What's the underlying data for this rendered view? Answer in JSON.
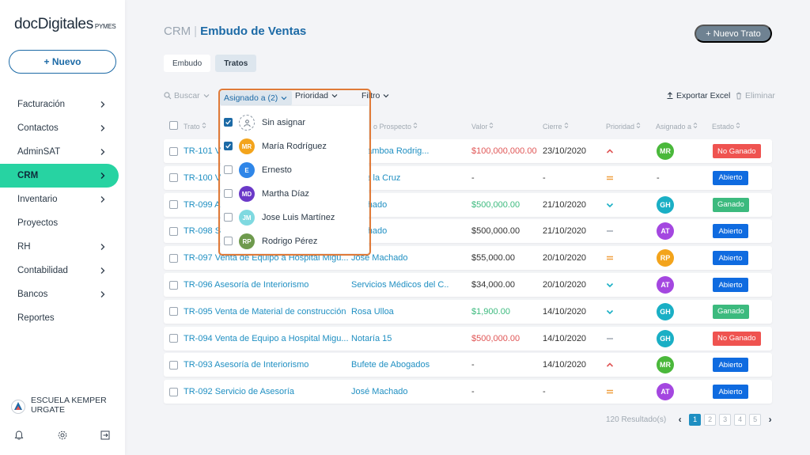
{
  "sidebar": {
    "logo_main": "docDigitales",
    "logo_sub": "PYMES",
    "new_label": "+ Nuevo",
    "items": [
      {
        "label": "Facturación",
        "chevron": true
      },
      {
        "label": "Contactos",
        "chevron": true
      },
      {
        "label": "AdminSAT",
        "chevron": true
      },
      {
        "label": "CRM",
        "chevron": true,
        "active": true
      },
      {
        "label": "Inventario",
        "chevron": true
      },
      {
        "label": "Proyectos",
        "chevron": false
      },
      {
        "label": "RH",
        "chevron": true
      },
      {
        "label": "Contabilidad",
        "chevron": true
      },
      {
        "label": "Bancos",
        "chevron": true
      },
      {
        "label": "Reportes",
        "chevron": false
      }
    ],
    "company_line1": "ESCUELA KEMPER",
    "company_line2": "URGATE"
  },
  "header": {
    "crumb_root": "CRM",
    "crumb_sep": "|",
    "crumb_current": "Embudo de Ventas",
    "new_deal_label": "+ Nuevo Trato"
  },
  "tabs": [
    {
      "label": "Embudo",
      "active": false
    },
    {
      "label": "Tratos",
      "active": true
    }
  ],
  "toolbar": {
    "search": "Buscar",
    "assigned": "Asignado a (2)",
    "priority": "Prioridad",
    "filter": "Filtro",
    "export": "Exportar Excel",
    "delete": "Eliminar"
  },
  "columns": {
    "deal": "Trato",
    "prospect": "o Prospecto",
    "value": "Valor",
    "close": "Cierre",
    "priority": "Prioridad",
    "assigned": "Asignado a",
    "status": "Estado"
  },
  "rows": [
    {
      "deal": "TR-101 V",
      "prospect": "io Gamboa Rodrig...",
      "value": "$100,000,000.00",
      "value_color": "red",
      "close": "23/10/2020",
      "priority": "up",
      "avatar": "MR",
      "avatar_color": "#4ab83b",
      "status": "No Ganado",
      "status_color": "#ef5350"
    },
    {
      "deal": "TR-100 V",
      "prospect": "to de la Cruz",
      "value": "-",
      "value_color": "plain",
      "close": "-",
      "priority": "equal",
      "avatar": "-",
      "avatar_color": "",
      "status": "Abierto",
      "status_color": "#0f6be0"
    },
    {
      "deal": "TR-099 A",
      "prospect": "Machado",
      "value": "$500,000.00",
      "value_color": "green",
      "close": "21/10/2020",
      "priority": "down",
      "avatar": "GH",
      "avatar_color": "#1aafc5",
      "status": "Ganado",
      "status_color": "#3cba7e"
    },
    {
      "deal": "TR-098 S",
      "prospect": "Machado",
      "value": "$500,000.00",
      "value_color": "plain",
      "close": "21/10/2020",
      "priority": "dash",
      "avatar": "AT",
      "avatar_color": "#a447e0",
      "status": "Abierto",
      "status_color": "#0f6be0"
    },
    {
      "deal": "TR-097 Venta de Equipo a Hospital Migu...",
      "prospect": "José Machado",
      "value": "$55,000.00",
      "value_color": "plain",
      "close": "20/10/2020",
      "priority": "equal",
      "avatar": "RP",
      "avatar_color": "#f3a41c",
      "status": "Abierto",
      "status_color": "#0f6be0"
    },
    {
      "deal": "TR-096 Asesoría de Interiorismo",
      "prospect": "Servicios Médicos del C...",
      "value": "$34,000.00",
      "value_color": "plain",
      "close": "20/10/2020",
      "priority": "down",
      "avatar": "AT",
      "avatar_color": "#a447e0",
      "status": "Abierto",
      "status_color": "#0f6be0"
    },
    {
      "deal": "TR-095 Venta de Material de construcción",
      "prospect": "Rosa Ulloa",
      "value": "$1,900.00",
      "value_color": "green",
      "close": "14/10/2020",
      "priority": "down",
      "avatar": "GH",
      "avatar_color": "#1aafc5",
      "status": "Ganado",
      "status_color": "#3cba7e"
    },
    {
      "deal": "TR-094 Venta de Equipo a Hospital Migu...",
      "prospect": "Notaría 15",
      "value": "$500,000.00",
      "value_color": "red",
      "close": "14/10/2020",
      "priority": "dash",
      "avatar": "GH",
      "avatar_color": "#1aafc5",
      "status": "No Ganado",
      "status_color": "#ef5350"
    },
    {
      "deal": "TR-093 Asesoría de Interiorismo",
      "prospect": "Bufete de Abogados",
      "value": "-",
      "value_color": "plain",
      "close": "14/10/2020",
      "priority": "up",
      "avatar": "MR",
      "avatar_color": "#4ab83b",
      "status": "Abierto",
      "status_color": "#0f6be0"
    },
    {
      "deal": "TR-092 Servicio de Asesoría",
      "prospect": "José Machado",
      "value": "-",
      "value_color": "plain",
      "close": "-",
      "priority": "equal",
      "avatar": "AT",
      "avatar_color": "#a447e0",
      "status": "Abierto",
      "status_color": "#0f6be0"
    }
  ],
  "dropdown": {
    "options": [
      {
        "label": "Sin asignar",
        "checked": true,
        "initials": "",
        "color": ""
      },
      {
        "label": "María Rodríguez",
        "checked": true,
        "initials": "MR",
        "color": "#f3a41c"
      },
      {
        "label": "Ernesto",
        "checked": false,
        "initials": "E",
        "color": "#2f86e8"
      },
      {
        "label": "Martha Díaz",
        "checked": false,
        "initials": "MD",
        "color": "#6b39c8"
      },
      {
        "label": "Jose Luis Martínez",
        "checked": false,
        "initials": "JM",
        "color": "#7fd9e0"
      },
      {
        "label": "Rodrigo Pérez",
        "checked": false,
        "initials": "RP",
        "color": "#6e9a4d"
      }
    ]
  },
  "pagination": {
    "results": "120 Resultado(s)",
    "pages": [
      "1",
      "2",
      "3",
      "4",
      "5"
    ],
    "current": "1"
  },
  "colors": {
    "accent": "#1c6aa6",
    "active_nav": "#27d3a2",
    "link": "#1f8fc2",
    "highlight": "#e07a38"
  }
}
